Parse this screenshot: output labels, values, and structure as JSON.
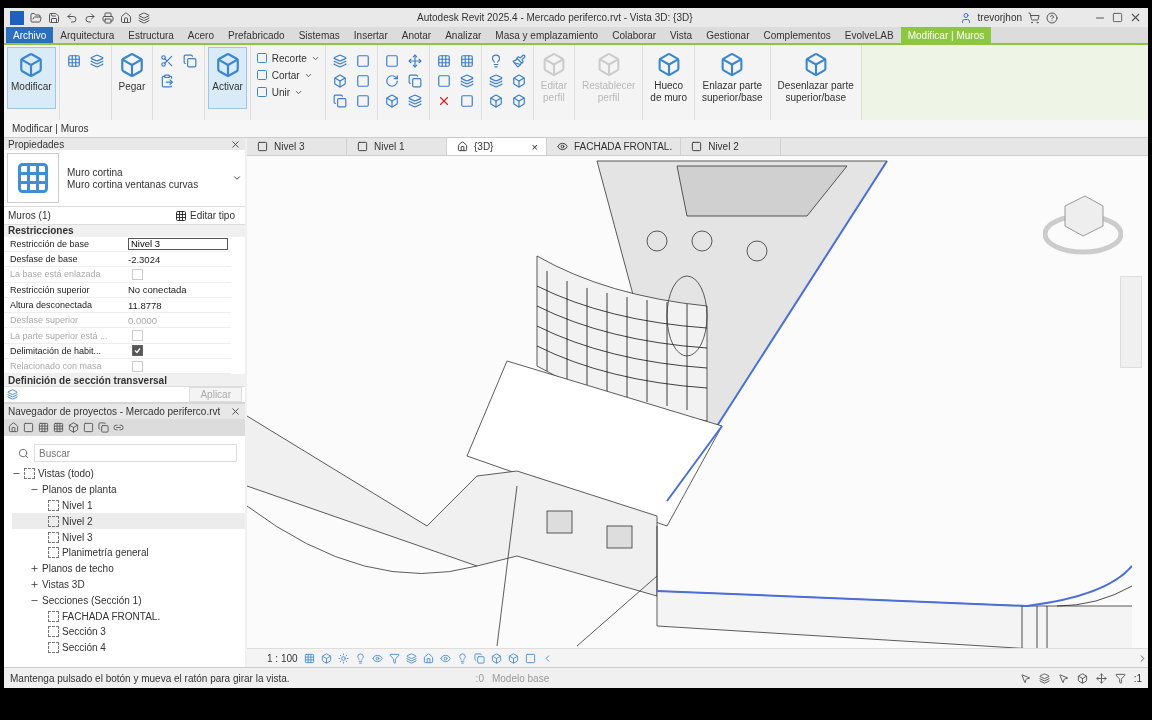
{
  "title_bar": {
    "title": "Autodesk Revit 2025.4 - Mercado periferco.rvt - Vista 3D: {3D}",
    "user": "trevorjhon"
  },
  "menu_tabs": [
    {
      "label": "Archivo",
      "kind": "file",
      "selected": false
    },
    {
      "label": "Arquitectura",
      "kind": "normal",
      "selected": false
    },
    {
      "label": "Estructura",
      "kind": "normal",
      "selected": false
    },
    {
      "label": "Acero",
      "kind": "normal",
      "selected": false
    },
    {
      "label": "Prefabricado",
      "kind": "normal",
      "selected": false
    },
    {
      "label": "Sistemas",
      "kind": "normal",
      "selected": false
    },
    {
      "label": "Insertar",
      "kind": "normal",
      "selected": false
    },
    {
      "label": "Anotar",
      "kind": "normal",
      "selected": false
    },
    {
      "label": "Analizar",
      "kind": "normal",
      "selected": false
    },
    {
      "label": "Masa y emplazamiento",
      "kind": "normal",
      "selected": false
    },
    {
      "label": "Colaborar",
      "kind": "normal",
      "selected": false
    },
    {
      "label": "Vista",
      "kind": "normal",
      "selected": false
    },
    {
      "label": "Gestionar",
      "kind": "normal",
      "selected": false
    },
    {
      "label": "Complementos",
      "kind": "normal",
      "selected": false
    },
    {
      "label": "EvolveLAB",
      "kind": "normal",
      "selected": false
    },
    {
      "label": "Modificar | Muros",
      "kind": "context",
      "selected": true
    }
  ],
  "ribbon": [
    {
      "kind": "large",
      "label": "Modificar",
      "active": true,
      "disabled": false
    },
    {
      "kind": "icon-grid"
    },
    {
      "kind": "large",
      "label": "Pegar",
      "active": false,
      "disabled": false
    },
    {
      "kind": "icon-grid"
    },
    {
      "kind": "large",
      "label": "Activar",
      "active": true,
      "disabled": false
    },
    {
      "kind": "stack",
      "labels": [
        "Recorte",
        "Cortar",
        "Unir"
      ]
    },
    {
      "kind": "icon-grid"
    },
    {
      "kind": "icon-grid"
    },
    {
      "kind": "icon-grid"
    },
    {
      "kind": "icon-grid"
    },
    {
      "kind": "large",
      "label": "Editar\nperfil",
      "active": false,
      "disabled": true
    },
    {
      "kind": "large",
      "label": "Restablecer\nperfil",
      "active": false,
      "disabled": true
    },
    {
      "kind": "large",
      "label": "Hueco\nde muro",
      "active": false,
      "disabled": false
    },
    {
      "kind": "large",
      "label": "Enlazar parte\nsuperior/base",
      "active": false,
      "disabled": false
    },
    {
      "kind": "large",
      "label": "Desenlazar parte\nsuperior/base",
      "active": false,
      "disabled": false
    }
  ],
  "options_bar": {
    "label": "Modificar | Muros"
  },
  "properties": {
    "title": "Propiedades",
    "type_family": "Muro cortina",
    "type_name": "Muro cortina ventanas curvas",
    "selector": "Muros (1)",
    "edit_type": "Editar tipo",
    "section": "Restricciones",
    "rows": [
      {
        "label": "Restricción de base",
        "value": "Nivel 3",
        "kind": "input",
        "disabled": false
      },
      {
        "label": "Desfase de base",
        "value": "-2.3024",
        "kind": "text",
        "disabled": false
      },
      {
        "label": "La base está enlazada",
        "kind": "checkbox",
        "checked": false,
        "disabled": true
      },
      {
        "label": "Restricción superior",
        "value": "No conectada",
        "kind": "text",
        "disabled": false
      },
      {
        "label": "Altura desconectada",
        "value": "11.8778",
        "kind": "text",
        "disabled": false
      },
      {
        "label": "Desfase superior",
        "value": "0.0000",
        "kind": "text",
        "disabled": true
      },
      {
        "label": "La parte superior está ...",
        "kind": "checkbox",
        "checked": false,
        "disabled": true
      },
      {
        "label": "Delimitación de habit...",
        "kind": "checkbox",
        "checked": true,
        "disabled": false
      },
      {
        "label": "Relacionado con masa",
        "kind": "checkbox",
        "checked": false,
        "disabled": true
      }
    ],
    "next_section": "Definición de sección transversal",
    "apply": "Aplicar"
  },
  "browser": {
    "title": "Navegador de proyectos - Mercado periferco.rvt",
    "search_placeholder": "Buscar",
    "tree": [
      {
        "label": "Vistas (todo)",
        "expanded": true,
        "selected": false,
        "children": [
          {
            "label": "Planos de planta",
            "expanded": true,
            "selected": false,
            "children": [
              {
                "label": "Nivel 1",
                "selected": false
              },
              {
                "label": "Nivel 2",
                "selected": true
              },
              {
                "label": "Nivel 3",
                "selected": false
              },
              {
                "label": "Planimetría general",
                "selected": false
              }
            ]
          },
          {
            "label": "Planos de techo",
            "expanded": false,
            "selected": false
          },
          {
            "label": "Vistas 3D",
            "expanded": false,
            "selected": false
          },
          {
            "label": "Secciones (Sección 1)",
            "expanded": true,
            "selected": false,
            "children": [
              {
                "label": "FACHADA FRONTAL.",
                "selected": false
              },
              {
                "label": "Sección 3",
                "selected": false
              },
              {
                "label": "Sección 4",
                "selected": false
              }
            ]
          }
        ]
      }
    ]
  },
  "view_tabs": [
    {
      "label": "Nivel 3",
      "kind": "plan",
      "selected": false
    },
    {
      "label": "Nivel 1",
      "kind": "plan",
      "selected": false
    },
    {
      "label": "{3D}",
      "kind": "perspective",
      "selected": true,
      "close": "×"
    },
    {
      "label": "FACHADA FRONTAL.",
      "kind": "section",
      "selected": false
    },
    {
      "label": "Nivel 2",
      "kind": "plan",
      "selected": false
    }
  ],
  "view_bar": {
    "scale": "1 : 100"
  },
  "status_bar": {
    "message": "Mantenga pulsado el botón y mueva el ratón para girar la vista.",
    "worksets": ":0",
    "model": "Modelo base",
    "filter": ":1"
  }
}
